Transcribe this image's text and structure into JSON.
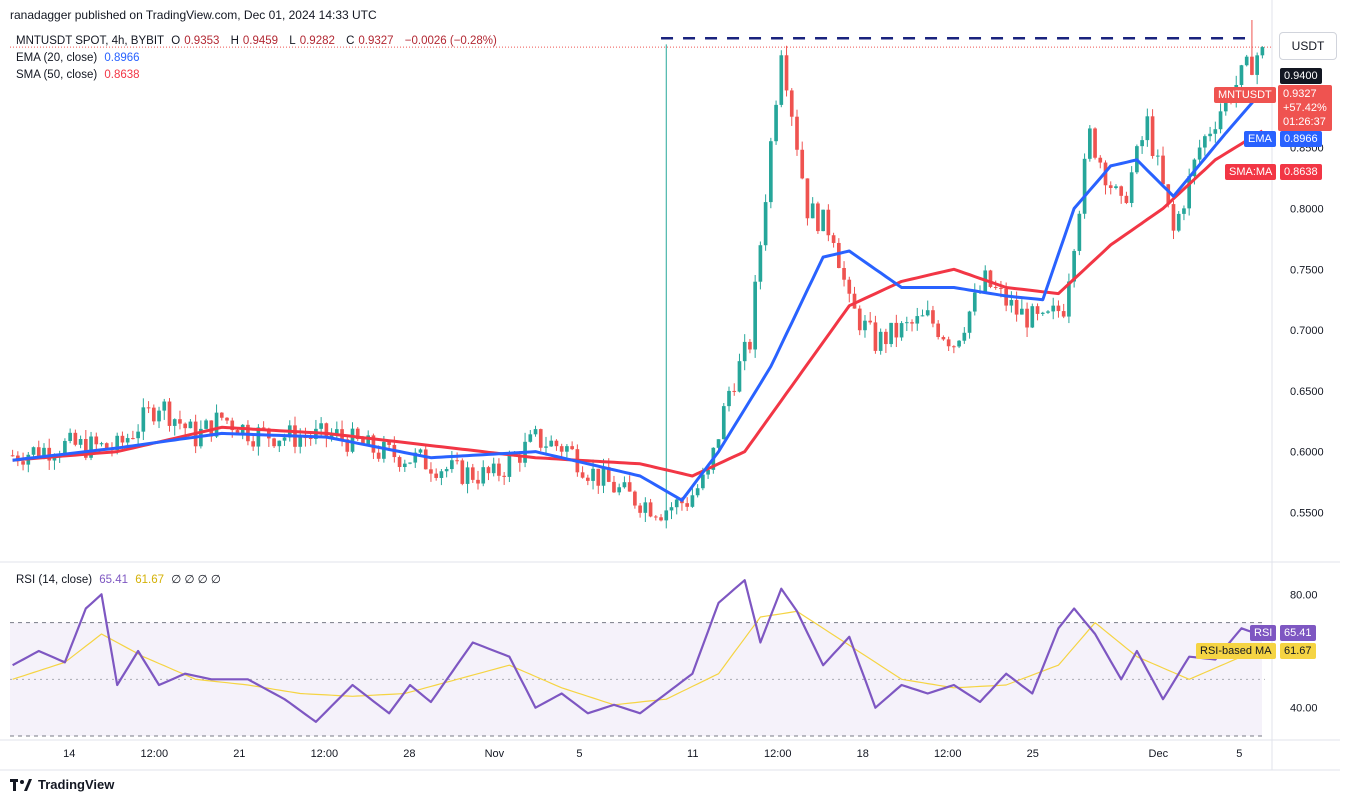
{
  "header": {
    "publisher": "ranadagger published on TradingView.com, Dec 01, 2024 14:33 UTC",
    "currency": "USDT"
  },
  "legend": {
    "symbol": "MNTUSDT SPOT, 4h, BYBIT",
    "o_label": "O",
    "o_value": "0.9353",
    "h_label": "H",
    "h_value": "0.9459",
    "l_label": "L",
    "l_value": "0.9282",
    "c_label": "C",
    "c_value": "0.9327",
    "change": "−0.0026 (−0.28%)",
    "ema_label": "EMA (20, close)",
    "ema_value": "0.8966",
    "sma_label": "SMA (50, close)",
    "sma_value": "0.8638"
  },
  "rsi_legend": {
    "label": "RSI (14, close)",
    "rsi_value": "65.41",
    "ma_value": "61.67",
    "empties": "∅ ∅ ∅ ∅"
  },
  "price_tags": {
    "level": "0.9400",
    "symbol": "MNTUSDT",
    "price": "0.9327",
    "change_pct": "+57.42%",
    "countdown": "01:26:37",
    "ema_tag": "EMA",
    "ema_value": "0.8966",
    "sma_tag": "SMA:MA",
    "sma_value": "0.8638",
    "rsi_tag": "RSI",
    "rsi_value": "65.41",
    "rsi_ma_tag": "RSI-based MA",
    "rsi_ma_value": "61.67"
  },
  "footer": {
    "brand": "TradingView"
  },
  "colors": {
    "up": "#26a69a",
    "down": "#ef5350",
    "ema": "#2962ff",
    "sma": "#f23645",
    "rsi": "#7e57c2",
    "rsi_ma": "#f5d443",
    "level": "#1a237e"
  },
  "chart_data": [
    {
      "type": "candlestick",
      "title": "MNTUSDT SPOT, 4h, BYBIT",
      "ylim": [
        0.515,
        0.955
      ],
      "y_ticks": [
        "0.8500",
        "0.8000",
        "0.7500",
        "0.7000",
        "0.6500",
        "0.6000",
        "0.5500"
      ],
      "y_tick_values": [
        0.85,
        0.8,
        0.75,
        0.7,
        0.65,
        0.6,
        0.55
      ],
      "x_ticks": [
        "14",
        "12:00",
        "21",
        "12:00",
        "28",
        "Nov",
        "5",
        "11",
        "12:00",
        "18",
        "12:00",
        "25",
        "Dec",
        "5"
      ],
      "horizontal_level": 0.94,
      "close_path": {
        "x": [
          0,
          10,
          20,
          28,
          35,
          40,
          46,
          55,
          62,
          70,
          78,
          85,
          92,
          100,
          106,
          110,
          117,
          124,
          129,
          133,
          137,
          141,
          147,
          152,
          157,
          160,
          165,
          170,
          175,
          180,
          186,
          192,
          197,
          201,
          206,
          212,
          217,
          222,
          227,
          232,
          239
        ],
        "y": [
          0.597,
          0.605,
          0.603,
          0.64,
          0.612,
          0.628,
          0.615,
          0.612,
          0.613,
          0.6,
          0.593,
          0.583,
          0.58,
          0.61,
          0.603,
          0.585,
          0.565,
          0.552,
          0.56,
          0.58,
          0.65,
          0.69,
          0.935,
          0.8,
          0.78,
          0.72,
          0.69,
          0.7,
          0.71,
          0.69,
          0.74,
          0.715,
          0.705,
          0.72,
          0.86,
          0.8,
          0.87,
          0.78,
          0.85,
          0.89,
          0.9327
        ]
      },
      "ema20": {
        "x": [
          0,
          20,
          40,
          60,
          80,
          100,
          120,
          128,
          135,
          145,
          155,
          160,
          170,
          180,
          190,
          197,
          203,
          210,
          215,
          222,
          232,
          239
        ],
        "y": [
          0.593,
          0.603,
          0.615,
          0.612,
          0.595,
          0.6,
          0.58,
          0.56,
          0.6,
          0.67,
          0.76,
          0.765,
          0.735,
          0.735,
          0.728,
          0.725,
          0.8,
          0.835,
          0.84,
          0.81,
          0.862,
          0.8966
        ]
      },
      "sma50": {
        "x": [
          0,
          20,
          40,
          60,
          80,
          100,
          120,
          130,
          140,
          150,
          160,
          170,
          180,
          190,
          200,
          210,
          220,
          230,
          239
        ],
        "y": [
          0.593,
          0.6,
          0.62,
          0.615,
          0.605,
          0.595,
          0.59,
          0.58,
          0.6,
          0.66,
          0.72,
          0.74,
          0.75,
          0.735,
          0.73,
          0.77,
          0.8,
          0.84,
          0.8638
        ]
      }
    },
    {
      "type": "line",
      "title": "RSI (14, close)",
      "ylim": [
        30,
        90
      ],
      "y_ticks": [
        "80.00",
        "40.00"
      ],
      "y_tick_values": [
        80,
        40
      ],
      "band": [
        30,
        70
      ],
      "midline": 50,
      "series": [
        {
          "name": "RSI",
          "x": [
            0,
            5,
            10,
            14,
            17,
            20,
            24,
            28,
            33,
            38,
            45,
            52,
            58,
            65,
            72,
            76,
            80,
            88,
            95,
            100,
            105,
            110,
            115,
            120,
            125,
            130,
            135,
            140,
            143,
            147,
            150,
            155,
            160,
            165,
            170,
            175,
            180,
            185,
            190,
            195,
            200,
            203,
            207,
            212,
            215,
            220,
            225,
            230,
            235,
            239
          ],
          "y": [
            55,
            60,
            56,
            75,
            80,
            48,
            60,
            48,
            52,
            50,
            50,
            43,
            35,
            48,
            38,
            48,
            42,
            63,
            58,
            40,
            45,
            38,
            41,
            38,
            45,
            52,
            77,
            85,
            63,
            82,
            74,
            55,
            65,
            40,
            48,
            45,
            48,
            42,
            52,
            45,
            68,
            75,
            66,
            50,
            60,
            43,
            58,
            57,
            68,
            65.41
          ]
        },
        {
          "name": "RSI-based MA",
          "x": [
            0,
            10,
            17,
            25,
            35,
            45,
            55,
            65,
            75,
            85,
            95,
            105,
            115,
            125,
            135,
            143,
            150,
            160,
            170,
            180,
            190,
            200,
            207,
            215,
            225,
            235,
            239
          ],
          "y": [
            50,
            56,
            66,
            58,
            50,
            48,
            45,
            44,
            45,
            50,
            55,
            47,
            41,
            43,
            52,
            72,
            74,
            62,
            50,
            47,
            48,
            55,
            70,
            58,
            50,
            58,
            61.67
          ]
        }
      ]
    }
  ]
}
